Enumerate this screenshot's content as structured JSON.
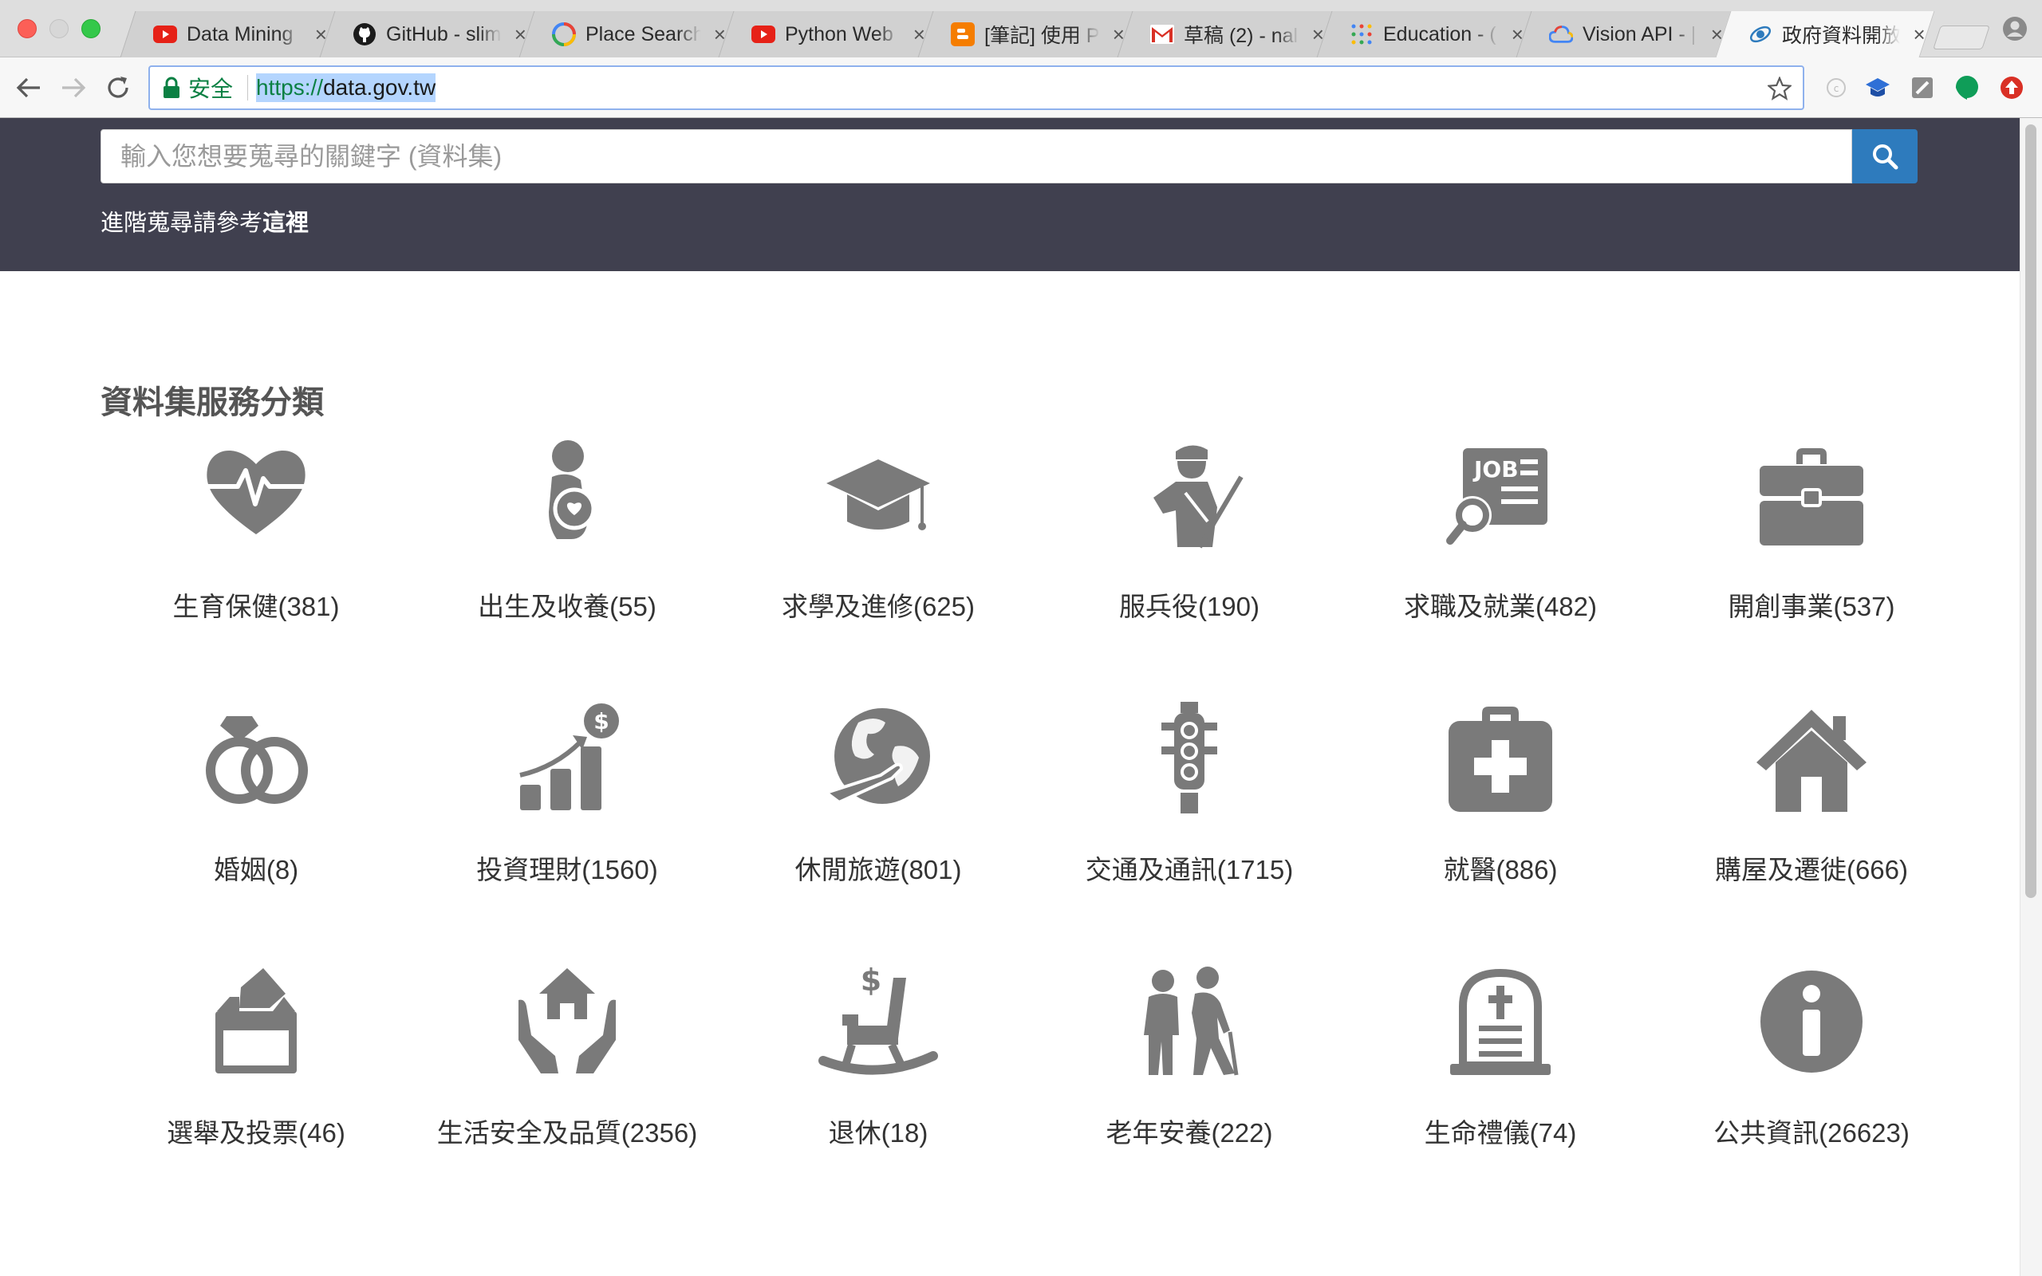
{
  "browser": {
    "tabs": [
      {
        "title": "Data Mining",
        "favicon": "youtube-icon"
      },
      {
        "title": "GitHub - slim",
        "favicon": "github-icon"
      },
      {
        "title": "Place Search",
        "favicon": "google-places-icon"
      },
      {
        "title": "Python Web",
        "favicon": "youtube-icon"
      },
      {
        "title": "[筆記] 使用 P",
        "favicon": "blogger-icon"
      },
      {
        "title": "草稿 (2) - nal",
        "favicon": "gmail-icon"
      },
      {
        "title": "Education - (",
        "favicon": "dots-icon"
      },
      {
        "title": "Vision API - |",
        "favicon": "google-cloud-icon"
      },
      {
        "title": "政府資料開放",
        "favicon": "gov-data-icon",
        "active": true
      }
    ],
    "omnibox": {
      "secure_label": "安全",
      "url_scheme": "https://",
      "url_host": "data.gov.tw"
    }
  },
  "search": {
    "placeholder": "輸入您想要蒐尋的關鍵字 (資料集)",
    "advanced_prefix": "進階蒐尋請參考",
    "advanced_link": "這裡"
  },
  "section_title": "資料集服務分類",
  "categories": [
    {
      "label": "生育保健(381)",
      "icon": "heartbeat-icon"
    },
    {
      "label": "出生及收養(55)",
      "icon": "mother-baby-icon"
    },
    {
      "label": "求學及進修(625)",
      "icon": "graduation-cap-icon"
    },
    {
      "label": "服兵役(190)",
      "icon": "soldier-icon"
    },
    {
      "label": "求職及就業(482)",
      "icon": "job-search-icon"
    },
    {
      "label": "開創事業(537)",
      "icon": "briefcase-icon"
    },
    {
      "label": "婚姻(8)",
      "icon": "wedding-rings-icon"
    },
    {
      "label": "投資理財(1560)",
      "icon": "investment-chart-icon"
    },
    {
      "label": "休閒旅遊(801)",
      "icon": "globe-plane-icon"
    },
    {
      "label": "交通及通訊(1715)",
      "icon": "traffic-light-icon"
    },
    {
      "label": "就醫(886)",
      "icon": "medical-kit-icon"
    },
    {
      "label": "購屋及遷徙(666)",
      "icon": "house-icon"
    },
    {
      "label": "選舉及投票(46)",
      "icon": "ballot-box-icon"
    },
    {
      "label": "生活安全及品質(2356)",
      "icon": "hands-house-icon"
    },
    {
      "label": "退休(18)",
      "icon": "rocking-chair-icon"
    },
    {
      "label": "老年安養(222)",
      "icon": "elderly-couple-icon"
    },
    {
      "label": "生命禮儀(74)",
      "icon": "tombstone-icon"
    },
    {
      "label": "公共資訊(26623)",
      "icon": "info-icon"
    }
  ],
  "colors": {
    "hero_bg": "#40404f",
    "search_button": "#2e7bbd",
    "icon_gray": "#7a7a7a",
    "secure_green": "#0b8043"
  }
}
